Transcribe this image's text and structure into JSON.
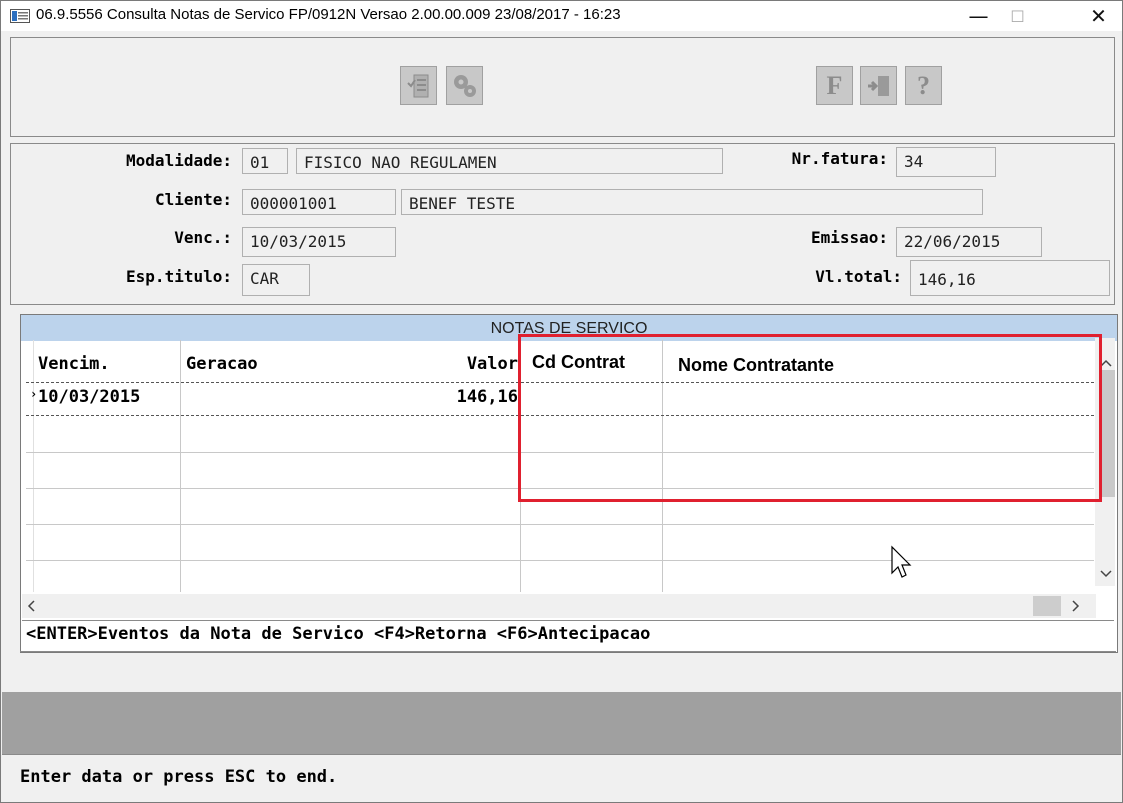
{
  "window": {
    "title": "06.9.5556 Consulta Notas de Servico FP/0912N Versao 2.00.00.009 23/08/2017 - 16:23",
    "minimize": "—",
    "maximize": "☐",
    "close": "✕"
  },
  "toolbar": {
    "left_group": [
      "checklist-icon",
      "gears-icon"
    ],
    "right_group": [
      {
        "icon": "f-icon",
        "glyph": "F"
      },
      {
        "icon": "exit-door-icon",
        "glyph": ""
      },
      {
        "icon": "help-icon",
        "glyph": "?"
      }
    ]
  },
  "header": {
    "modalidade_label": "Modalidade:",
    "modalidade_code": "01",
    "modalidade_desc": "FISICO NAO REGULAMEN",
    "nr_fatura_label": "Nr.fatura:",
    "nr_fatura_value": "34",
    "cliente_label": "Cliente:",
    "cliente_code": "000001001",
    "cliente_name": "BENEF TESTE",
    "venc_label": "Venc.:",
    "venc_value": "10/03/2015",
    "emissao_label": "Emissao:",
    "emissao_value": "22/06/2015",
    "esp_titulo_label": "Esp.titulo:",
    "esp_titulo_value": "CAR",
    "vl_total_label": "Vl.total:",
    "vl_total_value": "146,16"
  },
  "grid": {
    "caption": "NOTAS DE SERVICO",
    "columns": [
      "Vencim.",
      "Geracao",
      "Valor",
      "Cd Contrat",
      "Nome Contratante"
    ],
    "rows": [
      {
        "vencim": "10/03/2015",
        "geracao": "",
        "valor": "146,16",
        "cd_contrat": "",
        "nome_contratante": ""
      }
    ],
    "scroll_left": "<",
    "scroll_right": ">",
    "scroll_up": "^",
    "scroll_down": "v"
  },
  "hint": "<ENTER>Eventos da Nota de Servico <F4>Retorna <F6>Antecipacao",
  "status": "Enter data or press ESC to end.",
  "colors": {
    "grid_caption_bg": "#bcd3ec",
    "highlight_border": "#e0202f",
    "panel_bg": "#f0f0f0"
  }
}
